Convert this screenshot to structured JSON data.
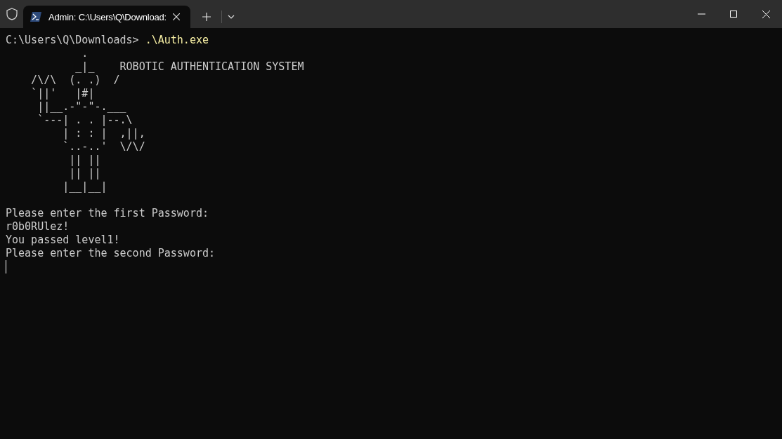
{
  "tabs": [
    {
      "title": "Admin: C:\\Users\\Q\\Download:",
      "selected": true
    }
  ],
  "terminal": {
    "lines": [
      {
        "kind": "command",
        "prompt": "C:\\Users\\Q\\Downloads> ",
        "command": ".\\Auth.exe"
      },
      {
        "kind": "art",
        "text": "            .\n           _|_    ROBOTIC AUTHENTICATION SYSTEM\n    /\\/\\  (. .)  /\n    `||'   |#|\n     ||__.-\"-\"-.___\n     `---| . . |--.\\\n         | : : |  ,||,\n         `..-..'  \\/\\/\n          || ||\n          || ||\n         |__|__|"
      },
      {
        "kind": "blank"
      },
      {
        "kind": "output",
        "text": "Please enter the first Password:"
      },
      {
        "kind": "output",
        "text": "r0b0RUlez!"
      },
      {
        "kind": "output",
        "text": "You passed level1!"
      },
      {
        "kind": "output",
        "text": "Please enter the second Password:"
      }
    ],
    "cursor_visible": true
  }
}
